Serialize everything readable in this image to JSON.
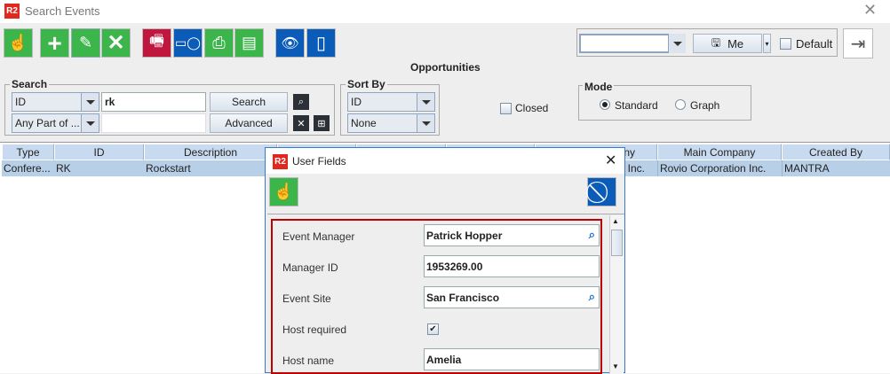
{
  "window": {
    "title": "Search Events",
    "logo": "R2",
    "close_icon": "close-icon"
  },
  "toolbar": {
    "icons": [
      "select-hand-icon",
      "add-icon",
      "edit-pencil-icon",
      "delete-x-icon",
      "fax-print-icon",
      "projector-icon",
      "printer-icon",
      "spreadsheet-icon",
      "view-network-icon",
      "book-icon"
    ]
  },
  "top_right": {
    "profile_value": "",
    "save_label": "Me",
    "default_label": "Default",
    "exit_icon": "exit-icon"
  },
  "section_title": "Opportunities",
  "search": {
    "legend": "Search",
    "field": "ID",
    "match": "Any Part of ...",
    "value": "rk",
    "value2": "",
    "search_btn": "Search",
    "advanced_btn": "Advanced"
  },
  "sort": {
    "legend": "Sort By",
    "first": "ID",
    "second": "None"
  },
  "closed_label": "Closed",
  "mode": {
    "legend": "Mode",
    "options": [
      "Standard",
      "Graph"
    ],
    "selected": "Standard"
  },
  "table": {
    "headers": [
      "Type",
      "ID",
      "Description",
      "",
      "",
      "",
      "ny",
      "Main Company",
      "Created By"
    ],
    "rows": [
      [
        "Confere...",
        "RK",
        "Rockstart",
        "",
        "",
        "",
        "Inc.",
        "Rovio Corporation Inc.",
        "MANTRA"
      ]
    ]
  },
  "dialog": {
    "title": "User Fields",
    "logo": "R2",
    "fields": [
      {
        "label": "Event Manager",
        "value": "Patrick  Hopper"
      },
      {
        "label": "Manager ID",
        "value": "1953269.00"
      },
      {
        "label": "Event Site",
        "value": "San Francisco"
      },
      {
        "label": "Host required",
        "value": "checked"
      },
      {
        "label": "Host name",
        "value": "Amelia"
      }
    ]
  },
  "colors": {
    "accent_green": "#3cb54a",
    "accent_blue": "#0a5cb8",
    "accent_red": "#c0173e",
    "highlight": "#c00000"
  }
}
